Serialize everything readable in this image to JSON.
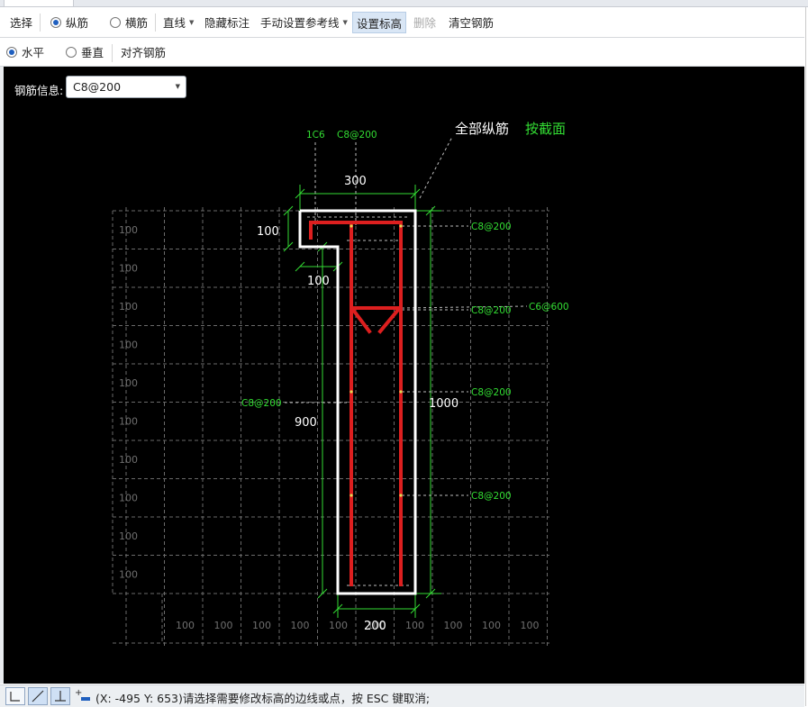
{
  "toolbar": {
    "select_label": "选择",
    "longitudinal_label": "纵筋",
    "transverse_label": "横筋",
    "line_label": "直线",
    "hide_label": "隐藏标注",
    "manual_ref_label": "手动设置参考线",
    "set_elev_label": "设置标高",
    "delete_label": "删除",
    "clear_label": "清空钢筋"
  },
  "toolbar2": {
    "horizontal_label": "水平",
    "vertical_label": "垂直",
    "align_label": "对齐钢筋"
  },
  "rebar_info": {
    "label": "钢筋信息:",
    "value": "C8@200"
  },
  "drawing": {
    "title_all": "全部纵筋",
    "title_section": "按截面",
    "top_labels": [
      "1C6",
      "C8@200"
    ],
    "dim_top": "300",
    "dim_flange_h": "100",
    "dim_flange_w": "100",
    "dim_web_h": "900",
    "dim_total_h": "1000",
    "dim_bottom": "200",
    "right_labels": [
      "C8@200",
      "C8@200",
      "C8@200",
      "C8@200"
    ],
    "c6_label": "C6@600",
    "left_label": "C8@200",
    "grid_label": "100",
    "left_grid_count": 10,
    "bottom_grid_count": 10
  },
  "status": {
    "text": "(X: -495 Y: 653)请选择需要修改标高的边线或点，按 ESC 键取消;"
  },
  "colors": {
    "green": "#33dd33",
    "rebar": "#dd1f1f",
    "outline": "#ffffff",
    "grid": "#6a6a6a"
  }
}
